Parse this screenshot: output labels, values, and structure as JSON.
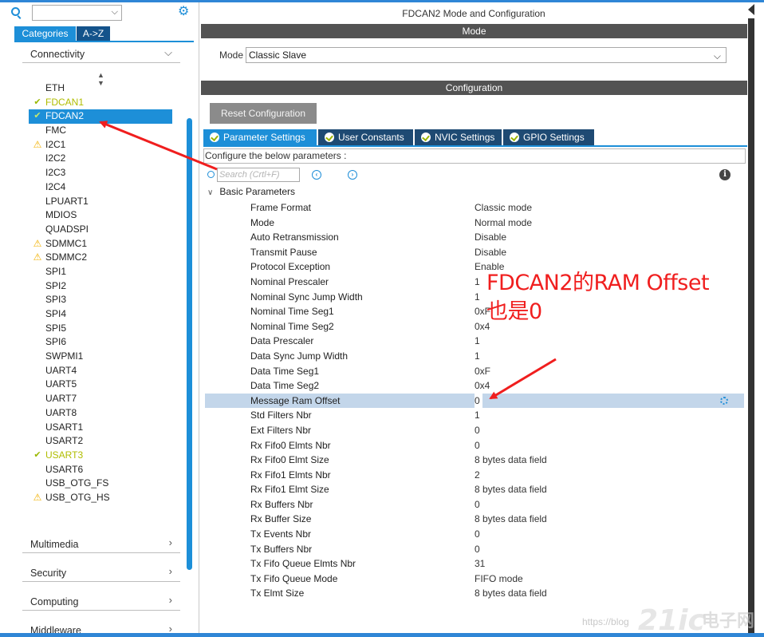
{
  "left": {
    "search_value": "",
    "tabs": {
      "categories": "Categories",
      "az": "A->Z"
    },
    "sections": {
      "connectivity": "Connectivity",
      "multimedia": "Multimedia",
      "security": "Security",
      "computing": "Computing",
      "middleware": "Middleware"
    },
    "peripherals": [
      {
        "name": "ETH",
        "status": "none"
      },
      {
        "name": "FDCAN1",
        "status": "ok"
      },
      {
        "name": "FDCAN2",
        "status": "ok",
        "selected": true
      },
      {
        "name": "FMC",
        "status": "none"
      },
      {
        "name": "I2C1",
        "status": "warn"
      },
      {
        "name": "I2C2",
        "status": "none"
      },
      {
        "name": "I2C3",
        "status": "none"
      },
      {
        "name": "I2C4",
        "status": "none"
      },
      {
        "name": "LPUART1",
        "status": "none"
      },
      {
        "name": "MDIOS",
        "status": "none"
      },
      {
        "name": "QUADSPI",
        "status": "none"
      },
      {
        "name": "SDMMC1",
        "status": "warn"
      },
      {
        "name": "SDMMC2",
        "status": "warn"
      },
      {
        "name": "SPI1",
        "status": "none"
      },
      {
        "name": "SPI2",
        "status": "none"
      },
      {
        "name": "SPI3",
        "status": "none"
      },
      {
        "name": "SPI4",
        "status": "none"
      },
      {
        "name": "SPI5",
        "status": "none"
      },
      {
        "name": "SPI6",
        "status": "none"
      },
      {
        "name": "SWPMI1",
        "status": "none"
      },
      {
        "name": "UART4",
        "status": "none"
      },
      {
        "name": "UART5",
        "status": "none"
      },
      {
        "name": "UART7",
        "status": "none"
      },
      {
        "name": "UART8",
        "status": "none"
      },
      {
        "name": "USART1",
        "status": "none"
      },
      {
        "name": "USART2",
        "status": "none"
      },
      {
        "name": "USART3",
        "status": "ok"
      },
      {
        "name": "USART6",
        "status": "none"
      },
      {
        "name": "USB_OTG_FS",
        "status": "none"
      },
      {
        "name": "USB_OTG_HS",
        "status": "warn"
      }
    ]
  },
  "right": {
    "title": "FDCAN2 Mode and Configuration",
    "mode_bar": "Mode",
    "mode_label": "Mode",
    "mode_value": "Classic Slave",
    "config_bar": "Configuration",
    "reset_button": "Reset Configuration",
    "config_tabs": [
      "Parameter Settings",
      "User Constants",
      "NVIC Settings",
      "GPIO Settings"
    ],
    "config_desc": "Configure the below parameters :",
    "search_placeholder": "Search (Crtl+F)",
    "group": "Basic Parameters",
    "params": [
      {
        "name": "Frame Format",
        "value": "Classic mode"
      },
      {
        "name": "Mode",
        "value": "Normal mode"
      },
      {
        "name": "Auto Retransmission",
        "value": "Disable"
      },
      {
        "name": "Transmit Pause",
        "value": "Disable"
      },
      {
        "name": "Protocol Exception",
        "value": "Enable"
      },
      {
        "name": "Nominal Prescaler",
        "value": "1"
      },
      {
        "name": "Nominal Sync Jump Width",
        "value": "1"
      },
      {
        "name": "Nominal Time Seg1",
        "value": "0xF"
      },
      {
        "name": "Nominal Time Seg2",
        "value": "0x4"
      },
      {
        "name": "Data Prescaler",
        "value": "1"
      },
      {
        "name": "Data Sync Jump Width",
        "value": "1"
      },
      {
        "name": "Data Time Seg1",
        "value": "0xF"
      },
      {
        "name": "Data Time Seg2",
        "value": "0x4"
      },
      {
        "name": "Message Ram Offset",
        "value": "0",
        "highlighted": true
      },
      {
        "name": "Std Filters Nbr",
        "value": "1"
      },
      {
        "name": "Ext Filters Nbr",
        "value": "0"
      },
      {
        "name": "Rx Fifo0 Elmts Nbr",
        "value": "0"
      },
      {
        "name": "Rx Fifo0 Elmt Size",
        "value": "8 bytes data field"
      },
      {
        "name": "Rx Fifo1 Elmts Nbr",
        "value": "2"
      },
      {
        "name": "Rx Fifo1 Elmt Size",
        "value": "8 bytes data field"
      },
      {
        "name": "Rx Buffers Nbr",
        "value": "0"
      },
      {
        "name": "Rx Buffer Size",
        "value": "8 bytes data field"
      },
      {
        "name": "Tx Events Nbr",
        "value": "0"
      },
      {
        "name": "Tx Buffers Nbr",
        "value": "0"
      },
      {
        "name": "Tx Fifo Queue Elmts Nbr",
        "value": "31"
      },
      {
        "name": "Tx Fifo Queue Mode",
        "value": "FIFO mode"
      },
      {
        "name": "Tx Elmt Size",
        "value": "8 bytes data field"
      }
    ]
  },
  "annotation": {
    "line1": "FDCAN2的RAM Offset",
    "line2": "也是0",
    "color": "#f01e1e"
  },
  "watermark": {
    "blog": "https://blog",
    "logo": "21ic",
    "cn": "电子网"
  },
  "colors": {
    "accent": "#1d8fd8",
    "dark_tab": "#1e4a73",
    "ok": "#9ab800",
    "warn": "#f2b100"
  }
}
